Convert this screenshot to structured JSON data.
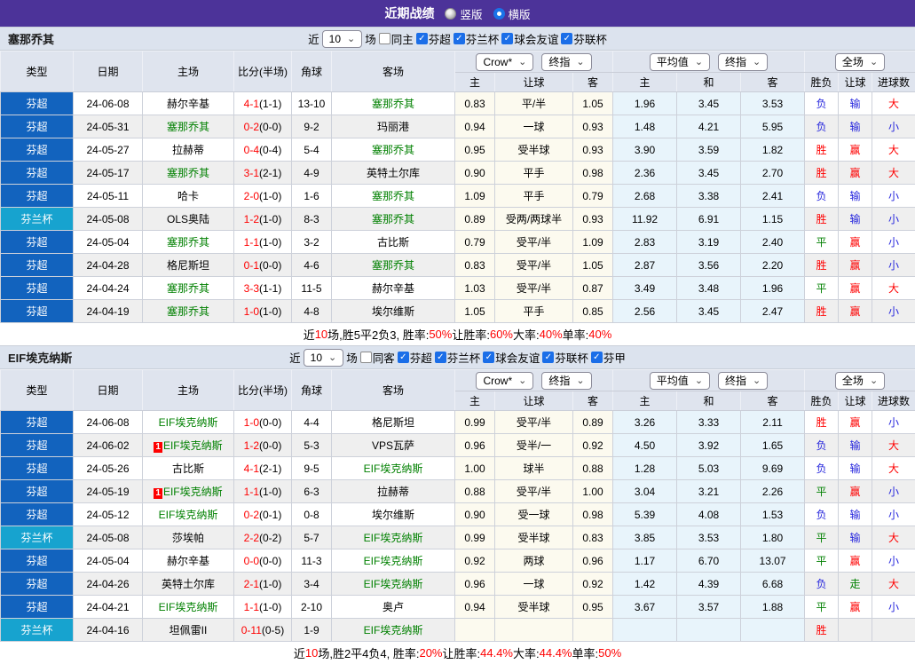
{
  "icons": {
    "chevron": "⌄",
    "check": "✓",
    "radio_vertical": "radio-unselected-gray",
    "radio_horizontal": "radio-selected-blue"
  },
  "palette": {
    "titlebar_bg": "#4c3399",
    "section_bg": "#dce3ee",
    "header_bg": "#dfe4ee",
    "league_super_bg": "#1263be",
    "league_cup_bg": "#17a3cf",
    "odds_col_bg": "#fcfaef",
    "avg_col_bg": "#e8f4fb",
    "win_color": "#fe0000",
    "draw_color": "#008000",
    "lose_color": "#2626dd",
    "self_team_color": "#008000",
    "score_color": "#fe0000",
    "accent_check": "#1b6ee8"
  },
  "title_bar": {
    "title": "近期战绩",
    "vertical_label": "竖版",
    "horizontal_label": "横版"
  },
  "columns": {
    "left": [
      "类型",
      "日期",
      "主场",
      "比分(半场)",
      "角球",
      "客场"
    ],
    "group1_selects": [
      "Crow*",
      "终指"
    ],
    "group2_selects": [
      "平均值",
      "终指"
    ],
    "group3_selects": [
      "全场"
    ],
    "sub": [
      "主",
      "让球",
      "客",
      "主",
      "和",
      "客",
      "胜负",
      "让球",
      "进球数"
    ]
  },
  "sections": [
    {
      "team": "塞那乔其",
      "filter": {
        "near": "近",
        "count": "10",
        "games": "场",
        "same": {
          "label": "同主",
          "checked": false
        },
        "leagues": [
          {
            "label": "芬超",
            "checked": true
          },
          {
            "label": "芬兰杯",
            "checked": true
          },
          {
            "label": "球会友谊",
            "checked": true
          },
          {
            "label": "芬联杯",
            "checked": true
          }
        ]
      },
      "rows": [
        {
          "league": "芬超",
          "cup": false,
          "date": "24-06-08",
          "home": "赫尔辛基",
          "home_self": false,
          "home_badge": "",
          "ft": "4-1",
          "ht": "(1-1)",
          "corner": "13-10",
          "away": "塞那乔其",
          "away_self": true,
          "o_home": "0.83",
          "handicap": "平/半",
          "o_away": "1.05",
          "a_home": "1.96",
          "a_draw": "3.45",
          "a_away": "3.53",
          "r1": [
            "负",
            "lose"
          ],
          "r2": [
            "输",
            "lose"
          ],
          "r3": [
            "大",
            "big"
          ]
        },
        {
          "league": "芬超",
          "cup": false,
          "date": "24-05-31",
          "home": "塞那乔其",
          "home_self": true,
          "home_badge": "",
          "ft": "0-2",
          "ht": "(0-0)",
          "corner": "9-2",
          "away": "玛丽港",
          "away_self": false,
          "o_home": "0.94",
          "handicap": "一球",
          "o_away": "0.93",
          "a_home": "1.48",
          "a_draw": "4.21",
          "a_away": "5.95",
          "r1": [
            "负",
            "lose"
          ],
          "r2": [
            "输",
            "lose"
          ],
          "r3": [
            "小",
            "small"
          ]
        },
        {
          "league": "芬超",
          "cup": false,
          "date": "24-05-27",
          "home": "拉赫蒂",
          "home_self": false,
          "home_badge": "",
          "ft": "0-4",
          "ht": "(0-4)",
          "corner": "5-4",
          "away": "塞那乔其",
          "away_self": true,
          "o_home": "0.95",
          "handicap": "受半球",
          "o_away": "0.93",
          "a_home": "3.90",
          "a_draw": "3.59",
          "a_away": "1.82",
          "r1": [
            "胜",
            "win"
          ],
          "r2": [
            "赢",
            "win"
          ],
          "r3": [
            "大",
            "big"
          ]
        },
        {
          "league": "芬超",
          "cup": false,
          "date": "24-05-17",
          "home": "塞那乔其",
          "home_self": true,
          "home_badge": "",
          "ft": "3-1",
          "ht": "(2-1)",
          "corner": "4-9",
          "away": "英特土尔库",
          "away_self": false,
          "o_home": "0.90",
          "handicap": "平手",
          "o_away": "0.98",
          "a_home": "2.36",
          "a_draw": "3.45",
          "a_away": "2.70",
          "r1": [
            "胜",
            "win"
          ],
          "r2": [
            "赢",
            "win"
          ],
          "r3": [
            "大",
            "big"
          ]
        },
        {
          "league": "芬超",
          "cup": false,
          "date": "24-05-11",
          "home": "哈卡",
          "home_self": false,
          "home_badge": "",
          "ft": "2-0",
          "ht": "(1-0)",
          "corner": "1-6",
          "away": "塞那乔其",
          "away_self": true,
          "o_home": "1.09",
          "handicap": "平手",
          "o_away": "0.79",
          "a_home": "2.68",
          "a_draw": "3.38",
          "a_away": "2.41",
          "r1": [
            "负",
            "lose"
          ],
          "r2": [
            "输",
            "lose"
          ],
          "r3": [
            "小",
            "small"
          ]
        },
        {
          "league": "芬兰杯",
          "cup": true,
          "date": "24-05-08",
          "home": "OLS奥陆",
          "home_self": false,
          "home_badge": "",
          "ft": "1-2",
          "ht": "(1-0)",
          "corner": "8-3",
          "away": "塞那乔其",
          "away_self": true,
          "o_home": "0.89",
          "handicap": "受两/两球半",
          "o_away": "0.93",
          "a_home": "11.92",
          "a_draw": "6.91",
          "a_away": "1.15",
          "r1": [
            "胜",
            "win"
          ],
          "r2": [
            "输",
            "lose"
          ],
          "r3": [
            "小",
            "small"
          ]
        },
        {
          "league": "芬超",
          "cup": false,
          "date": "24-05-04",
          "home": "塞那乔其",
          "home_self": true,
          "home_badge": "",
          "ft": "1-1",
          "ht": "(1-0)",
          "corner": "3-2",
          "away": "古比斯",
          "away_self": false,
          "o_home": "0.79",
          "handicap": "受平/半",
          "o_away": "1.09",
          "a_home": "2.83",
          "a_draw": "3.19",
          "a_away": "2.40",
          "r1": [
            "平",
            "draw"
          ],
          "r2": [
            "赢",
            "win"
          ],
          "r3": [
            "小",
            "small"
          ]
        },
        {
          "league": "芬超",
          "cup": false,
          "date": "24-04-28",
          "home": "格尼斯坦",
          "home_self": false,
          "home_badge": "",
          "ft": "0-1",
          "ht": "(0-0)",
          "corner": "4-6",
          "away": "塞那乔其",
          "away_self": true,
          "o_home": "0.83",
          "handicap": "受平/半",
          "o_away": "1.05",
          "a_home": "2.87",
          "a_draw": "3.56",
          "a_away": "2.20",
          "r1": [
            "胜",
            "win"
          ],
          "r2": [
            "赢",
            "win"
          ],
          "r3": [
            "小",
            "small"
          ]
        },
        {
          "league": "芬超",
          "cup": false,
          "date": "24-04-24",
          "home": "塞那乔其",
          "home_self": true,
          "home_badge": "",
          "ft": "3-3",
          "ht": "(1-1)",
          "corner": "11-5",
          "away": "赫尔辛基",
          "away_self": false,
          "o_home": "1.03",
          "handicap": "受平/半",
          "o_away": "0.87",
          "a_home": "3.49",
          "a_draw": "3.48",
          "a_away": "1.96",
          "r1": [
            "平",
            "draw"
          ],
          "r2": [
            "赢",
            "win"
          ],
          "r3": [
            "大",
            "big"
          ]
        },
        {
          "league": "芬超",
          "cup": false,
          "date": "24-04-19",
          "home": "塞那乔其",
          "home_self": true,
          "home_badge": "",
          "ft": "1-0",
          "ht": "(1-0)",
          "corner": "4-8",
          "away": "埃尔维斯",
          "away_self": false,
          "o_home": "1.05",
          "handicap": "平手",
          "o_away": "0.85",
          "a_home": "2.56",
          "a_draw": "3.45",
          "a_away": "2.47",
          "r1": [
            "胜",
            "win"
          ],
          "r2": [
            "赢",
            "win"
          ],
          "r3": [
            "小",
            "small"
          ]
        }
      ],
      "summary": [
        [
          "近",
          "k"
        ],
        [
          "10",
          "r"
        ],
        [
          "场,胜5平2负3, 胜率:",
          "k"
        ],
        [
          "50%",
          "r"
        ],
        [
          " 让胜率:",
          "k"
        ],
        [
          "60%",
          "r"
        ],
        [
          " 大率:",
          "k"
        ],
        [
          "40%",
          "r"
        ],
        [
          " 单率:",
          "k"
        ],
        [
          "40%",
          "r"
        ]
      ]
    },
    {
      "team": "EIF埃克纳斯",
      "filter": {
        "near": "近",
        "count": "10",
        "games": "场",
        "same": {
          "label": "同客",
          "checked": false
        },
        "leagues": [
          {
            "label": "芬超",
            "checked": true
          },
          {
            "label": "芬兰杯",
            "checked": true
          },
          {
            "label": "球会友谊",
            "checked": true
          },
          {
            "label": "芬联杯",
            "checked": true
          },
          {
            "label": "芬甲",
            "checked": true
          }
        ]
      },
      "rows": [
        {
          "league": "芬超",
          "cup": false,
          "date": "24-06-08",
          "home": "EIF埃克纳斯",
          "home_self": true,
          "home_badge": "",
          "ft": "1-0",
          "ht": "(0-0)",
          "corner": "4-4",
          "away": "格尼斯坦",
          "away_self": false,
          "o_home": "0.99",
          "handicap": "受平/半",
          "o_away": "0.89",
          "a_home": "3.26",
          "a_draw": "3.33",
          "a_away": "2.11",
          "r1": [
            "胜",
            "win"
          ],
          "r2": [
            "赢",
            "win"
          ],
          "r3": [
            "小",
            "small"
          ]
        },
        {
          "league": "芬超",
          "cup": false,
          "date": "24-06-02",
          "home": "EIF埃克纳斯",
          "home_self": true,
          "home_badge": "1",
          "ft": "1-2",
          "ht": "(0-0)",
          "corner": "5-3",
          "away": "VPS瓦萨",
          "away_self": false,
          "o_home": "0.96",
          "handicap": "受半/一",
          "o_away": "0.92",
          "a_home": "4.50",
          "a_draw": "3.92",
          "a_away": "1.65",
          "r1": [
            "负",
            "lose"
          ],
          "r2": [
            "输",
            "lose"
          ],
          "r3": [
            "大",
            "big"
          ]
        },
        {
          "league": "芬超",
          "cup": false,
          "date": "24-05-26",
          "home": "古比斯",
          "home_self": false,
          "home_badge": "",
          "ft": "4-1",
          "ht": "(2-1)",
          "corner": "9-5",
          "away": "EIF埃克纳斯",
          "away_self": true,
          "o_home": "1.00",
          "handicap": "球半",
          "o_away": "0.88",
          "a_home": "1.28",
          "a_draw": "5.03",
          "a_away": "9.69",
          "r1": [
            "负",
            "lose"
          ],
          "r2": [
            "输",
            "lose"
          ],
          "r3": [
            "大",
            "big"
          ]
        },
        {
          "league": "芬超",
          "cup": false,
          "date": "24-05-19",
          "home": "EIF埃克纳斯",
          "home_self": true,
          "home_badge": "1",
          "ft": "1-1",
          "ht": "(1-0)",
          "corner": "6-3",
          "away": "拉赫蒂",
          "away_self": false,
          "o_home": "0.88",
          "handicap": "受平/半",
          "o_away": "1.00",
          "a_home": "3.04",
          "a_draw": "3.21",
          "a_away": "2.26",
          "r1": [
            "平",
            "draw"
          ],
          "r2": [
            "赢",
            "win"
          ],
          "r3": [
            "小",
            "small"
          ]
        },
        {
          "league": "芬超",
          "cup": false,
          "date": "24-05-12",
          "home": "EIF埃克纳斯",
          "home_self": true,
          "home_badge": "",
          "ft": "0-2",
          "ht": "(0-1)",
          "corner": "0-8",
          "away": "埃尔维斯",
          "away_self": false,
          "o_home": "0.90",
          "handicap": "受一球",
          "o_away": "0.98",
          "a_home": "5.39",
          "a_draw": "4.08",
          "a_away": "1.53",
          "r1": [
            "负",
            "lose"
          ],
          "r2": [
            "输",
            "lose"
          ],
          "r3": [
            "小",
            "small"
          ]
        },
        {
          "league": "芬兰杯",
          "cup": true,
          "date": "24-05-08",
          "home": "莎埃帕",
          "home_self": false,
          "home_badge": "",
          "ft": "2-2",
          "ht": "(0-2)",
          "corner": "5-7",
          "away": "EIF埃克纳斯",
          "away_self": true,
          "o_home": "0.99",
          "handicap": "受半球",
          "o_away": "0.83",
          "a_home": "3.85",
          "a_draw": "3.53",
          "a_away": "1.80",
          "r1": [
            "平",
            "draw"
          ],
          "r2": [
            "输",
            "lose"
          ],
          "r3": [
            "大",
            "big"
          ]
        },
        {
          "league": "芬超",
          "cup": false,
          "date": "24-05-04",
          "home": "赫尔辛基",
          "home_self": false,
          "home_badge": "",
          "ft": "0-0",
          "ht": "(0-0)",
          "corner": "11-3",
          "away": "EIF埃克纳斯",
          "away_self": true,
          "o_home": "0.92",
          "handicap": "两球",
          "o_away": "0.96",
          "a_home": "1.17",
          "a_draw": "6.70",
          "a_away": "13.07",
          "r1": [
            "平",
            "draw"
          ],
          "r2": [
            "赢",
            "win"
          ],
          "r3": [
            "小",
            "small"
          ]
        },
        {
          "league": "芬超",
          "cup": false,
          "date": "24-04-26",
          "home": "英特土尔库",
          "home_self": false,
          "home_badge": "",
          "ft": "2-1",
          "ht": "(1-0)",
          "corner": "3-4",
          "away": "EIF埃克纳斯",
          "away_self": true,
          "o_home": "0.96",
          "handicap": "一球",
          "o_away": "0.92",
          "a_home": "1.42",
          "a_draw": "4.39",
          "a_away": "6.68",
          "r1": [
            "负",
            "lose"
          ],
          "r2": [
            "走",
            "walk"
          ],
          "r3": [
            "大",
            "big"
          ]
        },
        {
          "league": "芬超",
          "cup": false,
          "date": "24-04-21",
          "home": "EIF埃克纳斯",
          "home_self": true,
          "home_badge": "",
          "ft": "1-1",
          "ht": "(1-0)",
          "corner": "2-10",
          "away": "奥卢",
          "away_self": false,
          "o_home": "0.94",
          "handicap": "受半球",
          "o_away": "0.95",
          "a_home": "3.67",
          "a_draw": "3.57",
          "a_away": "1.88",
          "r1": [
            "平",
            "draw"
          ],
          "r2": [
            "赢",
            "win"
          ],
          "r3": [
            "小",
            "small"
          ]
        },
        {
          "league": "芬兰杯",
          "cup": true,
          "date": "24-04-16",
          "home": "坦佩雷II",
          "home_self": false,
          "home_badge": "",
          "ft": "0-11",
          "ht": "(0-5)",
          "corner": "1-9",
          "away": "EIF埃克纳斯",
          "away_self": true,
          "o_home": "",
          "handicap": "",
          "o_away": "",
          "a_home": "",
          "a_draw": "",
          "a_away": "",
          "r1": [
            "胜",
            "win"
          ],
          "r2": [
            "",
            ""
          ],
          "r3": [
            "",
            ""
          ]
        }
      ],
      "summary": [
        [
          "近",
          "k"
        ],
        [
          "10",
          "r"
        ],
        [
          "场,胜2平4负4, 胜率:",
          "k"
        ],
        [
          "20%",
          "r"
        ],
        [
          " 让胜率:",
          "k"
        ],
        [
          "44.4%",
          "r"
        ],
        [
          " 大率:",
          "k"
        ],
        [
          "44.4%",
          "r"
        ],
        [
          " 单率:",
          "k"
        ],
        [
          "50%",
          "r"
        ]
      ]
    }
  ]
}
